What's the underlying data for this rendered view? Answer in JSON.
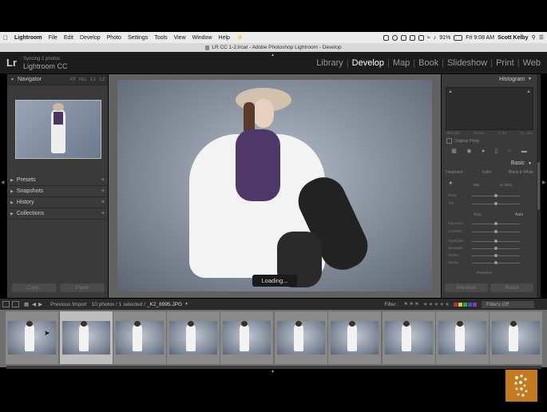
{
  "menubar": {
    "app": "Lightroom",
    "items": [
      "File",
      "Edit",
      "Develop",
      "Photo",
      "Settings",
      "Tools",
      "View",
      "Window",
      "Help"
    ],
    "battery": "91%",
    "clock": "Fri 9:08 AM",
    "user": "Scott Kelby"
  },
  "window": {
    "title": "LR CC 1-2.lrcat - Adobe Photoshop Lightroom - Develop"
  },
  "identity": {
    "logo": "Lr",
    "sync_status": "Syncing 2 photos",
    "product": "Lightroom CC"
  },
  "modules": [
    "Library",
    "Develop",
    "Map",
    "Book",
    "Slideshow",
    "Print",
    "Web"
  ],
  "active_module": "Develop",
  "left_panel": {
    "navigator": "Navigator",
    "zoom_options": [
      "FIT",
      "FILL",
      "1:1",
      "1:2"
    ],
    "sections": [
      "Presets",
      "Snapshots",
      "History",
      "Collections"
    ],
    "copy_button": "Copy...",
    "paste_button": "Paste"
  },
  "center": {
    "loading": "Loading..."
  },
  "right_panel": {
    "histogram": "Histogram",
    "hist_info": [
      "ISO 100",
      "70 mm",
      "f / 10",
      "¹⁄₁₆₀ sec"
    ],
    "original_photo": "Original Photo",
    "basic": "Basic",
    "basic_tabs": [
      "Treatment :",
      "Color",
      "Black & White"
    ],
    "wb_label": "WB :",
    "wb_value": "As Shot",
    "tone_label": "Tone",
    "tone_auto": "Auto",
    "presence_label": "Presence",
    "sliders": [
      "Temp",
      "Tint",
      "Exposure",
      "Contrast",
      "Highlights",
      "Shadows",
      "Whites",
      "Blacks"
    ],
    "previous_button": "Previous",
    "reset_button": "Reset"
  },
  "filmstrip": {
    "source": "Previous Import",
    "info": "10 photos / 1 selected /",
    "filename": "_K2_8995.JPG",
    "filter_label": "Filter :",
    "filter_state": "Filters Off",
    "thumb_count": 10,
    "selected_index": 1
  },
  "colors": {
    "badge": "#c57a1f",
    "panel": "#3a3a3a",
    "active_module": "#ffffff"
  }
}
